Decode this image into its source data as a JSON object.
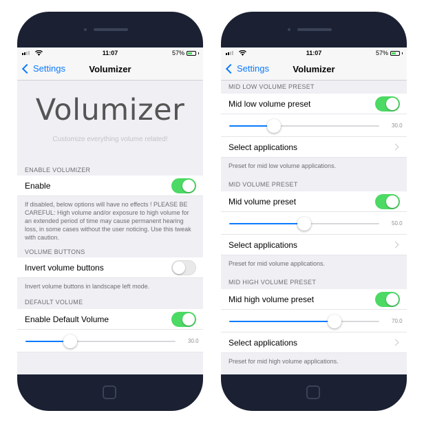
{
  "status": {
    "time": "11:07",
    "battery": "57%",
    "battery_level": 0.57
  },
  "nav": {
    "back_label": "Settings",
    "title": "Volumizer"
  },
  "left": {
    "hero_title": "Volumizer",
    "hero_subtitle": "Customize everything volume related!",
    "sec_enable_header": "ENABLE VOLUMIZER",
    "enable_label": "Enable",
    "enable_on": true,
    "enable_footer": "If disabled, below options will have no effects ! PLEASE BE CAREFUL: High volume and/or exposure to high volume for an extended period of time may cause permanent hearing loss, in some cases without the user noticing. Use this tweak with caution.",
    "sec_buttons_header": "VOLUME BUTTONS",
    "invert_label": "Invert volume buttons",
    "invert_on": false,
    "invert_footer": "Invert volume buttons in landscape left mode.",
    "sec_default_header": "DEFAULT VOLUME",
    "default_label": "Enable Default Volume",
    "default_on": true,
    "default_slider_value": 30,
    "default_slider_text": "30.0"
  },
  "right": {
    "sec_midlow_header": "MID LOW VOLUME PRESET",
    "midlow_label": "Mid low volume preset",
    "midlow_on": true,
    "midlow_slider_value": 30,
    "midlow_slider_text": "30.0",
    "midlow_select_label": "Select applications",
    "midlow_footer": "Preset for mid low volume applications.",
    "sec_mid_header": "MID VOLUME PRESET",
    "mid_label": "Mid volume preset",
    "mid_on": true,
    "mid_slider_value": 50,
    "mid_slider_text": "50.0",
    "mid_select_label": "Select applications",
    "mid_footer": "Preset for mid volume applications.",
    "sec_midhigh_header": "MID HIGH VOLUME PRESET",
    "midhigh_label": "Mid high volume preset",
    "midhigh_on": true,
    "midhigh_slider_value": 70,
    "midhigh_slider_text": "70.0",
    "midhigh_select_label": "Select applications",
    "midhigh_footer": "Preset for mid high volume applications."
  },
  "colors": {
    "accent": "#0a7aff",
    "toggle_on": "#4cd964",
    "phone": "#1b2133"
  }
}
